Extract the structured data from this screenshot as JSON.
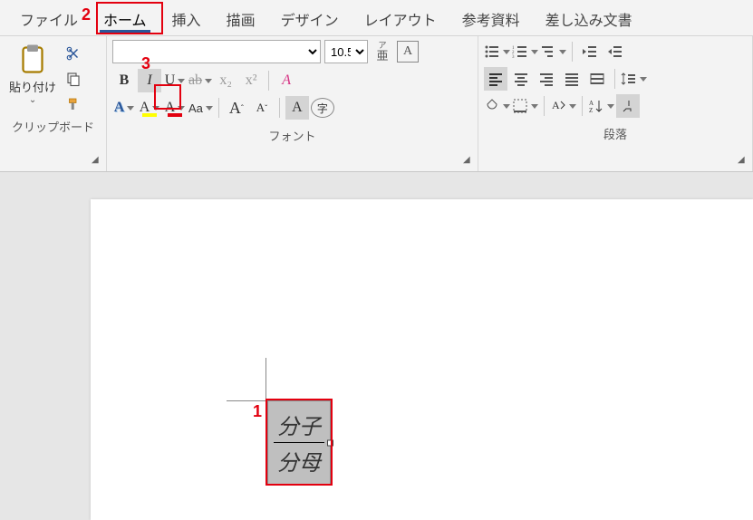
{
  "tabs": {
    "file": "ファイル",
    "home": "ホーム",
    "insert": "挿入",
    "draw": "描画",
    "design": "デザイン",
    "layout": "レイアウト",
    "references": "参考資料",
    "mailings": "差し込み文書"
  },
  "clipboard": {
    "paste": "貼り付け",
    "group_label": "クリップボード"
  },
  "font": {
    "font_name": "",
    "font_size": "10.5",
    "bold": "B",
    "italic": "I",
    "underline": "U",
    "strike": "ab",
    "sub": "x₂",
    "sup": "x²",
    "texteffect": "A",
    "highlight": "A",
    "fontcolor": "A",
    "case": "Aa",
    "growfont": "A",
    "shrinkfont": "A",
    "shade": "A",
    "enclosed": "字",
    "ruby": "ア\n亜",
    "charframe": "A",
    "clear_format": "A",
    "group_label": "フォント"
  },
  "paragraph": {
    "group_label": "段落"
  },
  "equation": {
    "numerator": "分子",
    "denominator": "分母"
  },
  "annotations": {
    "a1": "1",
    "a2": "2",
    "a3": "3"
  }
}
